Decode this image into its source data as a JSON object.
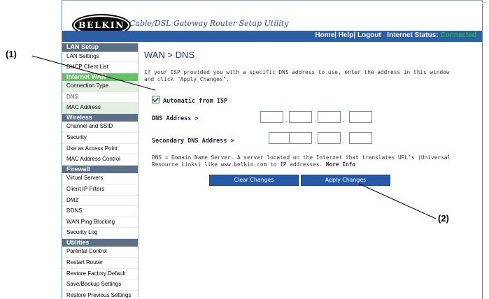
{
  "header": {
    "logo": "BELKIN",
    "tagline": "Cable/DSL Gateway Router Setup Utility",
    "nav": [
      "Home",
      "Help",
      "Logout"
    ],
    "status_label": "Internet Status:",
    "status_value": "Connected"
  },
  "sidebar": {
    "sections": [
      {
        "title": "LAN Setup",
        "items": [
          "LAN Settings",
          "DHCP Client List"
        ]
      },
      {
        "title": "Internet WAN",
        "items": [
          "Connection Type",
          "DNS",
          "MAC Address"
        ]
      },
      {
        "title": "Wireless",
        "items": [
          "Channel and SSID",
          "Security",
          "Use as Access Point",
          "MAC Address Control"
        ]
      },
      {
        "title": "Firewall",
        "items": [
          "Virtual Servers",
          "Client IP Filters",
          "DMZ",
          "DDNS",
          "WAN Ping Blocking",
          "Security Log"
        ]
      },
      {
        "title": "Utilities",
        "items": [
          "Parental Control",
          "Restart Router",
          "Restore Factory Default",
          "Save/Backup Settings",
          "Restore Previous Settings"
        ]
      }
    ]
  },
  "main": {
    "title": "WAN > DNS",
    "intro": "If your ISP provided you with a specific DNS address to use, enter the address in this window and click \"Apply Changes\".",
    "auto_label": "Automatic from ISP",
    "dns_label": "DNS Address >",
    "secondary_label": "Secondary DNS Address >",
    "note": "DNS = Domain Name Server. A server located on the Internet that translates URL's (Universal Resource Links) like www.belkin.com to IP addresses.",
    "more_info": "More Info",
    "clear_label": "Clear Changes",
    "apply_label": "Apply Changes"
  },
  "callouts": {
    "one": "(1)",
    "two": "(2)"
  },
  "colors": {
    "accent": "#2d5ea8",
    "status_green": "#22c322",
    "sidebar_header": "#5b6f86",
    "active_item": "#e02020"
  }
}
